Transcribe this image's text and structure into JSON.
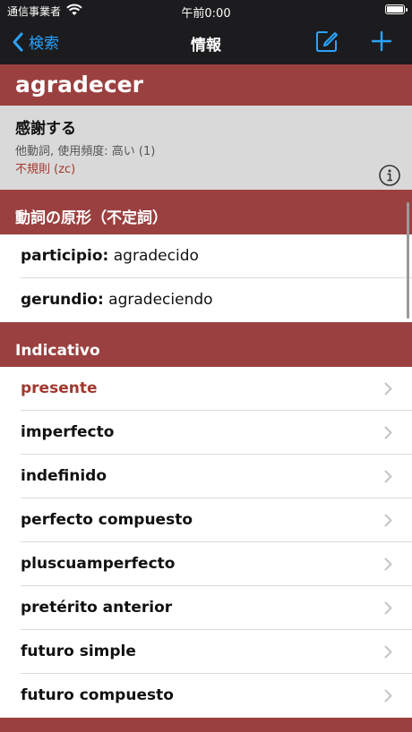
{
  "status": {
    "carrier": "通信事業者",
    "time": "午前0:00"
  },
  "nav": {
    "back_label": "検索",
    "title": "情報"
  },
  "word": {
    "headword": "agradecer",
    "meaning": "感謝する",
    "meta": "他動詞, 使用頻度: 高い (1)",
    "irregular": "不規則 (zc)"
  },
  "infinitive": {
    "header": "動詞の原形（不定詞）",
    "participle_key": "participio:",
    "participle_val": " agradecido",
    "gerund_key": "gerundio:",
    "gerund_val": " agradeciendo"
  },
  "indicativo": {
    "header": "Indicativo",
    "items": [
      {
        "label": "presente"
      },
      {
        "label": "imperfecto"
      },
      {
        "label": "indefinido"
      },
      {
        "label": "perfecto compuesto"
      },
      {
        "label": "pluscuamperfecto"
      },
      {
        "label": "pretérito anterior"
      },
      {
        "label": "futuro simple"
      },
      {
        "label": "futuro compuesto"
      }
    ]
  },
  "colors": {
    "accent": "#9b4040",
    "tint": "#2aa3ff",
    "active_text": "#a1382f"
  },
  "icons": [
    "wifi-icon",
    "battery-icon",
    "chevron-left-icon",
    "compose-icon",
    "plus-icon",
    "info-icon",
    "chevron-right-icon"
  ]
}
